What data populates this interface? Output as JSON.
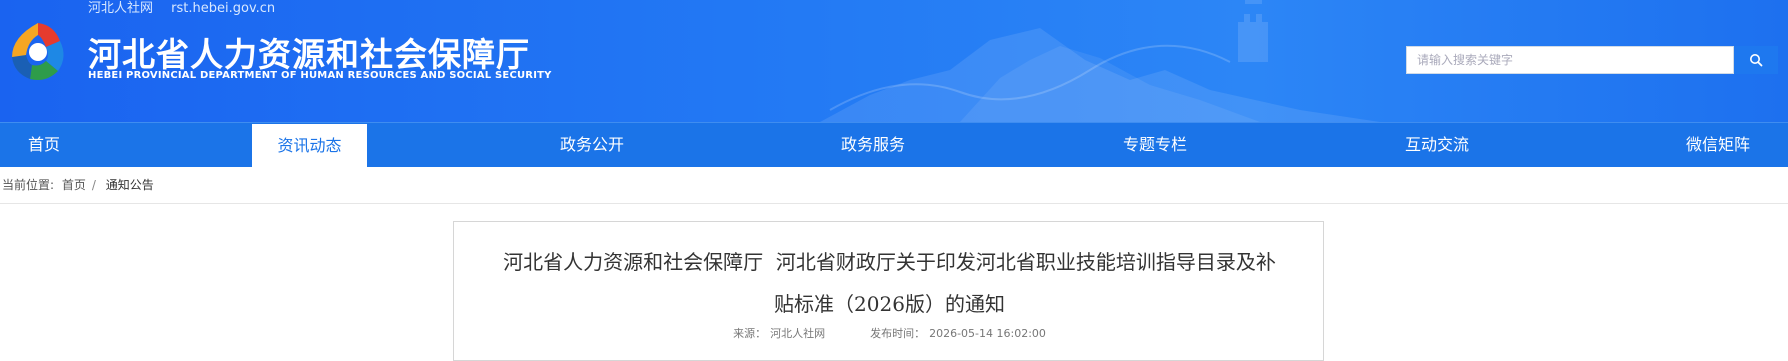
{
  "site_tag": {
    "name": "河北人社网",
    "domain": "rst.hebei.gov.cn"
  },
  "header": {
    "title_cn": "河北省人力资源和社会保障厅",
    "title_en": "HEBEI PROVINCIAL DEPARTMENT OF HUMAN RESOURCES AND SOCIAL SECURITY",
    "logo_icon": "pentagon-petal-logo-icon"
  },
  "search": {
    "placeholder": "请输入搜索关键字",
    "button_icon": "search-icon"
  },
  "nav": {
    "items": [
      {
        "label": "首页"
      },
      {
        "label": "资讯动态",
        "active": true
      },
      {
        "label": "政务公开"
      },
      {
        "label": "政务服务"
      },
      {
        "label": "专题专栏"
      },
      {
        "label": "互动交流"
      },
      {
        "label": "微信矩阵"
      }
    ]
  },
  "breadcrumb": {
    "prefix": "当前位置:",
    "home": "首页",
    "separator": "/",
    "current": "通知公告"
  },
  "article": {
    "title_line1": "河北省人力资源和社会保障厅  河北省财政厅关于印发河北省职业技能培训指导目录及补",
    "title_line2": "贴标准（2026版）的通知",
    "source_label": "来源：",
    "source": "河北人社网",
    "date_label": "发布时间：",
    "date": "2026-05-14 16:02:00"
  },
  "colors": {
    "brand_blue": "#1b74e8",
    "banner_blue": "#237af4"
  }
}
